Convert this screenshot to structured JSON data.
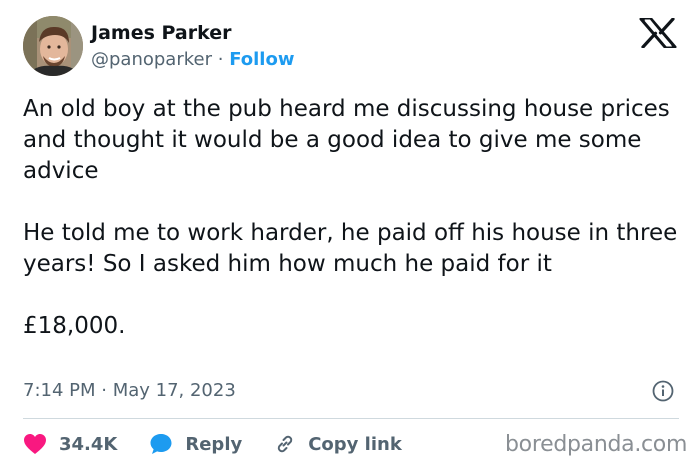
{
  "tweet": {
    "author_name": "James Parker",
    "handle": "@panoparker",
    "separator": "·",
    "follow_label": "Follow",
    "paragraphs": [
      "An old boy at the pub heard me discussing house prices and thought it would be a good idea to give me some advice",
      "He told me to work harder, he paid off his house in three years! So I asked him how much he paid for it",
      "£18,000."
    ],
    "timestamp": "7:14 PM · May 17, 2023"
  },
  "actions": {
    "like_count": "34.4K",
    "reply_label": "Reply",
    "copy_link_label": "Copy link"
  },
  "watermark": "boredpanda.com",
  "icons": {
    "platform_logo": "x-logo-icon",
    "info": "info-icon",
    "like": "heart-icon",
    "reply": "reply-bubble-icon",
    "copy_link": "link-icon"
  },
  "colors": {
    "text": "#0f1419",
    "secondary_text": "#536471",
    "follow": "#1d9bf0",
    "like": "#f91880",
    "reply": "#1d9bf0",
    "divider": "#cfd9de"
  }
}
